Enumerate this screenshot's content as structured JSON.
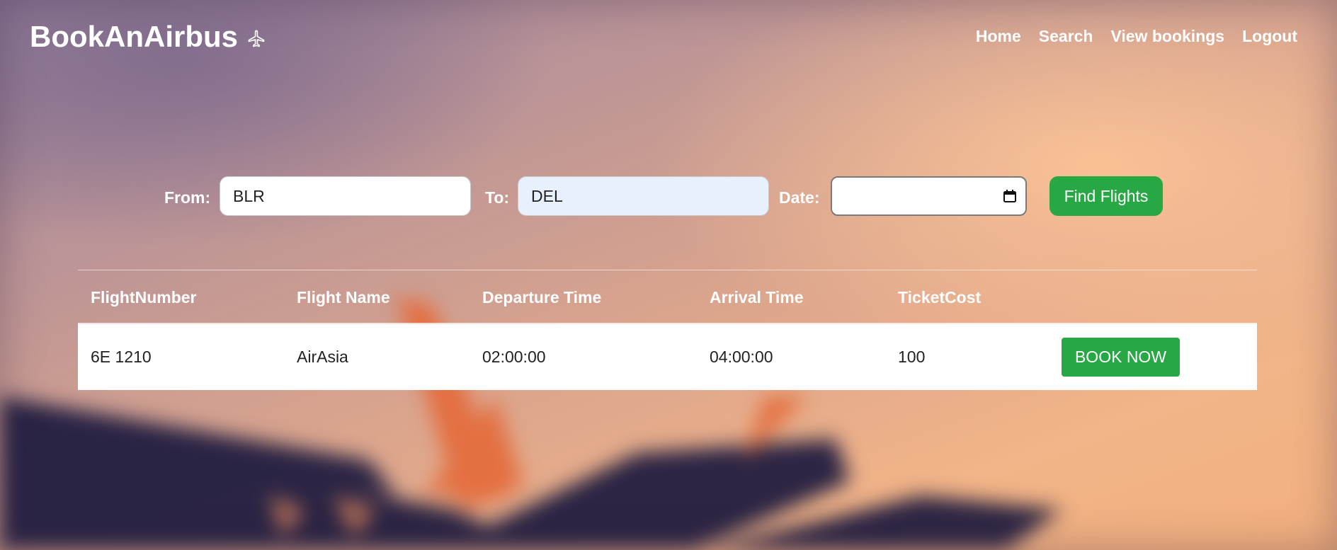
{
  "brand": {
    "title": "BookAnAirbus",
    "icon": "airplane-icon"
  },
  "nav": {
    "home": "Home",
    "search": "Search",
    "view_bookings": "View bookings",
    "logout": "Logout"
  },
  "search": {
    "from_label": "From:",
    "from_value": "BLR",
    "to_label": "To:",
    "to_value": "DEL",
    "date_label": "Date:",
    "date_value": "",
    "date_icon": "calendar-icon",
    "find_button": "Find Flights"
  },
  "table": {
    "headers": [
      "FlightNumber",
      "Flight Name",
      "Departure Time",
      "Arrival Time",
      "TicketCost",
      ""
    ],
    "rows": [
      {
        "flight_number": "6E 1210",
        "flight_name": "AirAsia",
        "departure": "02:00:00",
        "arrival": "04:00:00",
        "cost": "100",
        "action": "BOOK NOW"
      }
    ]
  },
  "colors": {
    "accent": "#28a745",
    "text_light": "#ffffff"
  }
}
